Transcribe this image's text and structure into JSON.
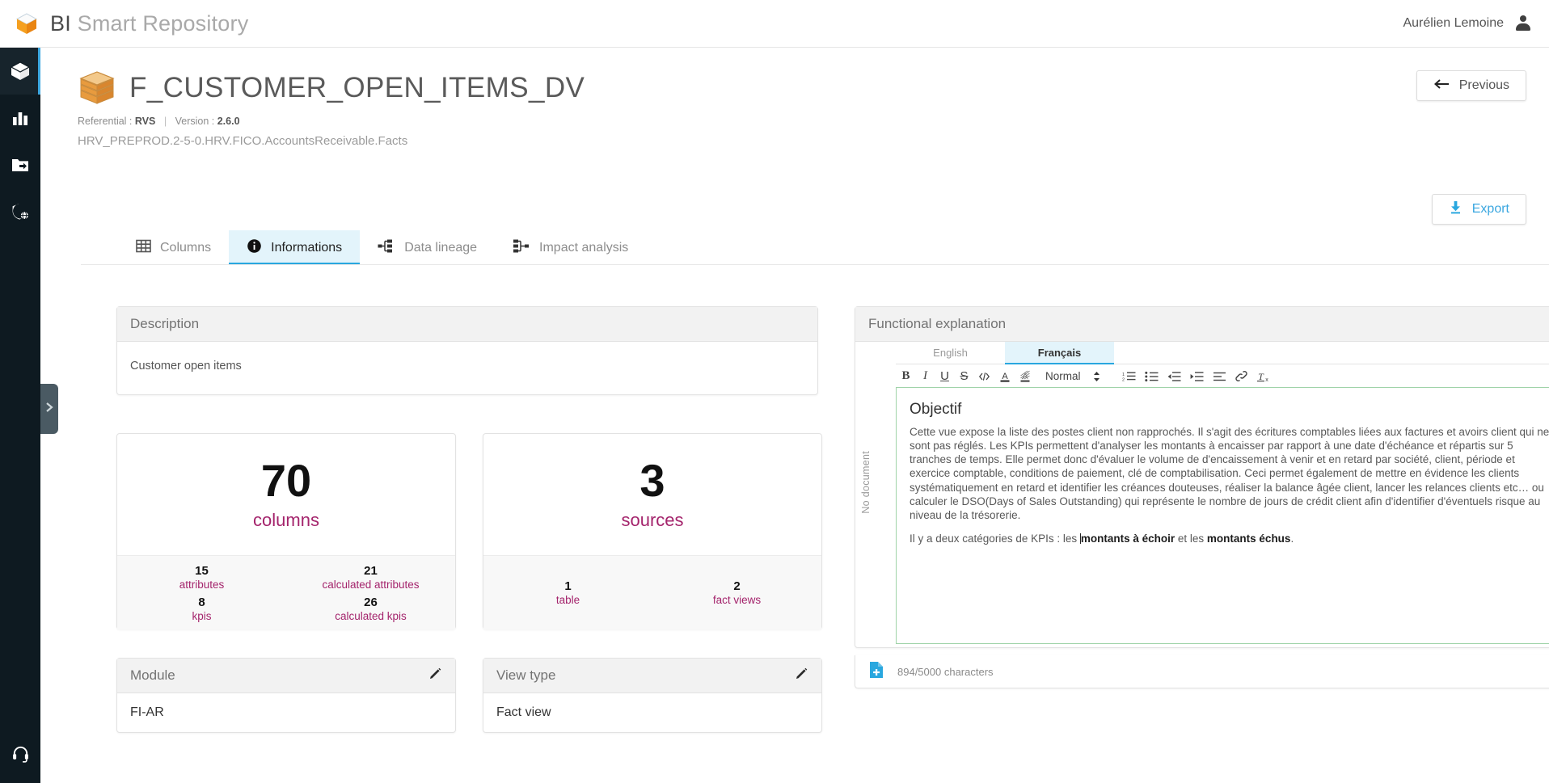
{
  "app": {
    "brand_first": "BI",
    "brand_second": "Smart Repository",
    "logo_icon": "cube-icon"
  },
  "header": {
    "user_name": "Aurélien Lemoine",
    "avatar_icon": "user-avatar-icon"
  },
  "sidebar": {
    "items": [
      {
        "icon": "cube-icon",
        "active": true
      },
      {
        "icon": "bar-chart-icon",
        "active": false
      },
      {
        "icon": "folder-export-icon",
        "active": false
      },
      {
        "icon": "shield-globe-icon",
        "active": false
      }
    ],
    "bottom": {
      "icon": "headset-support-icon"
    },
    "expander_icon": "chevron-right-icon"
  },
  "page": {
    "object_icon": "stacked-box-icon",
    "title": "F_CUSTOMER_OPEN_ITEMS_DV",
    "meta": {
      "referential_label": "Referential :",
      "referential_value": "RVS",
      "separator": "|",
      "version_label": "Version :",
      "version_value": "2.6.0"
    },
    "path": "HRV_PREPROD.2-5-0.HRV.FICO.AccountsReceivable.Facts",
    "previous_button": "Previous",
    "previous_icon": "arrow-left-icon",
    "export_button": "Export",
    "export_icon": "download-icon"
  },
  "tabs": [
    {
      "label": "Columns",
      "icon": "grid-table-icon",
      "active": false
    },
    {
      "label": "Informations",
      "icon": "info-circle-icon",
      "active": true
    },
    {
      "label": "Data lineage",
      "icon": "lineage-icon",
      "active": false
    },
    {
      "label": "Impact analysis",
      "icon": "impact-icon",
      "active": false
    }
  ],
  "description": {
    "title": "Description",
    "body": "Customer open items"
  },
  "stats": [
    {
      "value": "70",
      "label": "columns",
      "subs": [
        {
          "value": "15",
          "label": "attributes"
        },
        {
          "value": "21",
          "label": "calculated attributes"
        },
        {
          "value": "8",
          "label": "kpis"
        },
        {
          "value": "26",
          "label": "calculated kpis"
        }
      ]
    },
    {
      "value": "3",
      "label": "sources",
      "subs": [
        {
          "value": "1",
          "label": "table"
        },
        {
          "value": "2",
          "label": "fact views"
        }
      ]
    }
  ],
  "module": {
    "title": "Module",
    "value": "FI-AR",
    "edit_icon": "pencil-icon"
  },
  "view_type": {
    "title": "View type",
    "value": "Fact view",
    "edit_icon": "pencil-icon"
  },
  "functional_explanation": {
    "title": "Functional explanation",
    "lang_tabs": [
      {
        "label": "English",
        "active": false
      },
      {
        "label": "Français",
        "active": true
      }
    ],
    "toolbar": {
      "bold": "B",
      "italic": "I",
      "underline": "U",
      "strike": "S",
      "code": "code-icon",
      "font_color": "font-color-icon",
      "highlight": "highlight-icon",
      "style_select": "Normal",
      "style_caret": "updown-caret-icon",
      "ordered_list": "ordered-list-icon",
      "bullet_list": "bullet-list-icon",
      "outdent": "outdent-icon",
      "indent": "indent-icon",
      "align": "align-icon",
      "link": "link-icon",
      "clear_format": "clear-format-icon"
    },
    "no_document_label": "No document",
    "editor": {
      "heading": "Objectif",
      "paragraph1": "Cette vue expose la liste des postes client non rapprochés. Il s'agit des écritures comptables liées aux factures et avoirs client qui ne sont pas réglés. Les KPIs permettent d'analyser les montants à encaisser par rapport à une date d'échéance et répartis sur 5 tranches de temps. Elle permet donc d'évaluer le volume de d'encaissement à venir et en retard par société, client, période et exercice comptable, conditions de paiement, clé de comptabilisation. Ceci permet également de mettre en évidence les clients systématiquement en retard et identifier les créances douteuses, réaliser la balance âgée client, lancer les relances clients etc… ou calculer le DSO(Days of Sales Outstanding) qui représente le nombre de jours de crédit client afin d'identifier d'éventuels risque au niveau de la trésorerie.",
      "paragraph2_a": "Il y a deux catégories de KPIs : les ",
      "paragraph2_b": "montants à échoir",
      "paragraph2_c": " et les ",
      "paragraph2_d": "montants échus",
      "paragraph2_e": "."
    },
    "footer": {
      "doc_icon": "document-add-icon",
      "char_count": "894/5000 characters"
    }
  },
  "colors": {
    "accent_blue": "#29a7df",
    "magenta": "#a4246c",
    "rail_bg": "#0e1a21",
    "brand_orange": "#f39019",
    "editor_border": "#9fd3a8"
  }
}
